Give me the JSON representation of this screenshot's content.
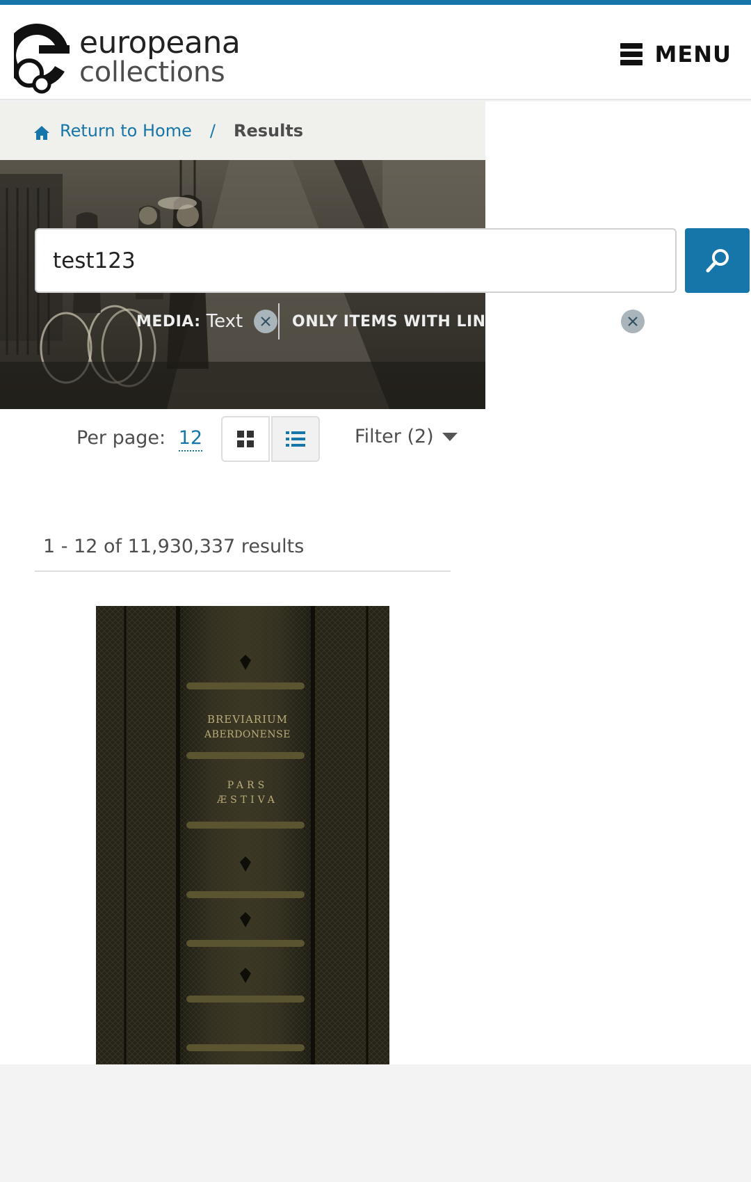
{
  "header": {
    "logo_line1": "europeana",
    "logo_line2": "collections",
    "menu_label": "MENU"
  },
  "breadcrumb": {
    "home_label": "Return to Home",
    "separator": "/",
    "current": "Results"
  },
  "search": {
    "query": "test123"
  },
  "filters": [
    {
      "key": "MEDIA:",
      "value": "Text"
    },
    {
      "key": "ONLY ITEMS WITH LINKS",
      "value": ""
    }
  ],
  "toolbar": {
    "per_page_label": "Per page:",
    "per_page_value": "12",
    "filter_label": "Filter (2)"
  },
  "results": {
    "count_text": "1 - 12 of 11,930,337 results"
  },
  "result_item": {
    "spine_line1": "BREVIARIUM",
    "spine_line2": "ABERDONENSE",
    "spine_line3": "PARS",
    "spine_line4": "ÆSTIVA"
  },
  "colors": {
    "accent": "#1676aa",
    "breadcrumb_bg": "#f0f0ec"
  }
}
